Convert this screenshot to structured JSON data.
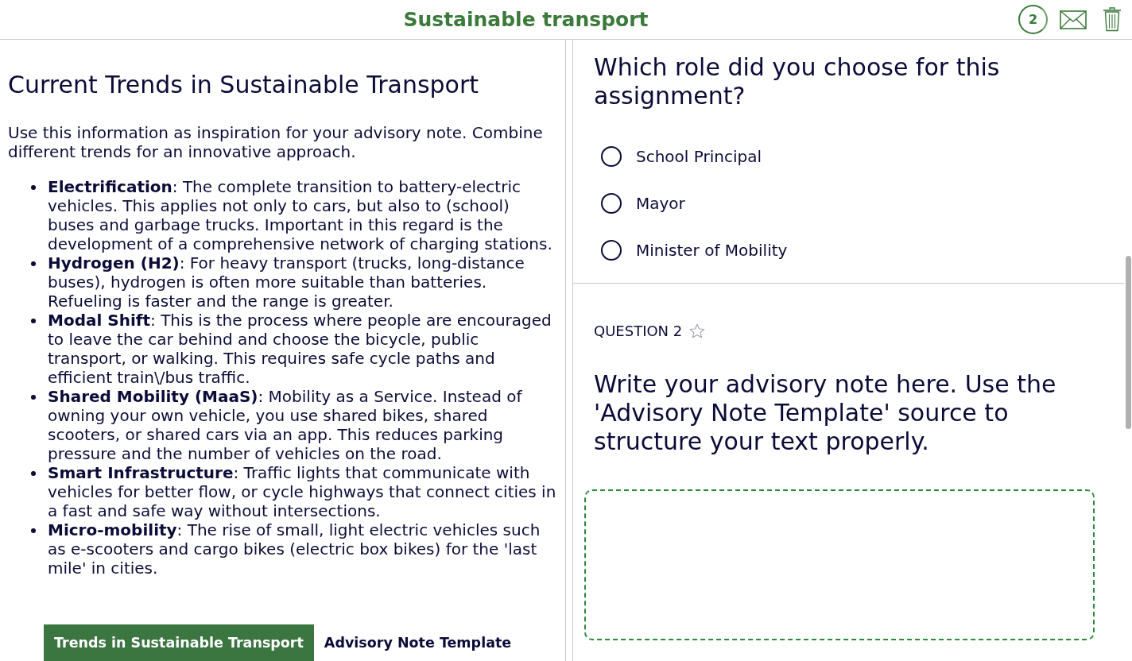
{
  "header": {
    "title": "Sustainable transport",
    "counter": "2"
  },
  "source_panel": {
    "heading": "Current Trends in Sustainable Transport",
    "intro": "Use this information as inspiration for your advisory note. Combine different trends for an innovative approach.",
    "items": [
      "**Electrification**: The complete transition to battery-electric vehicles. This applies not only to cars, but also to (school) buses and garbage trucks. Important in this regard is the development of a comprehensive network of charging stations.",
      "**Hydrogen (H2)**: For heavy transport (trucks, long-distance buses), hydrogen is often more suitable than batteries. Refueling is faster and the range is greater.",
      "**Modal Shift**: This is the process where people are encouraged to leave the car behind and choose the bicycle, public transport, or walking. This requires safe cycle paths and efficient train\\/bus traffic.",
      "**Shared Mobility (MaaS)**: Mobility as a Service. Instead of owning your own vehicle, you use shared bikes, shared scooters, or shared cars via an app. This reduces parking pressure and the number of vehicles on the road.",
      "**Smart Infrastructure**: Traffic lights that communicate with vehicles for better flow, or cycle highways that connect cities in a fast and safe way without intersections.",
      "**Micro-mobility**: The rise of small, light electric vehicles such as e-scooters and cargo bikes (electric box bikes) for the 'last mile' in cities."
    ],
    "tabs": [
      {
        "label": "Trends in Sustainable Transport",
        "selected": true
      },
      {
        "label": "Advisory Note Template",
        "selected": false
      }
    ]
  },
  "questions": [
    {
      "kind": "choice",
      "prompt": "Which role did you choose for this assignment?",
      "options": [
        {
          "label": "School Principal",
          "selected": false
        },
        {
          "label": "Mayor",
          "selected": false
        },
        {
          "label": "Minister of Mobility",
          "selected": false
        }
      ]
    },
    {
      "kind": "essay",
      "number_label": "QUESTION 2",
      "flagged": false,
      "prompt": "Write your advisory note here. Use the 'Advisory Note Template' source to structure your text properly."
    }
  ]
}
